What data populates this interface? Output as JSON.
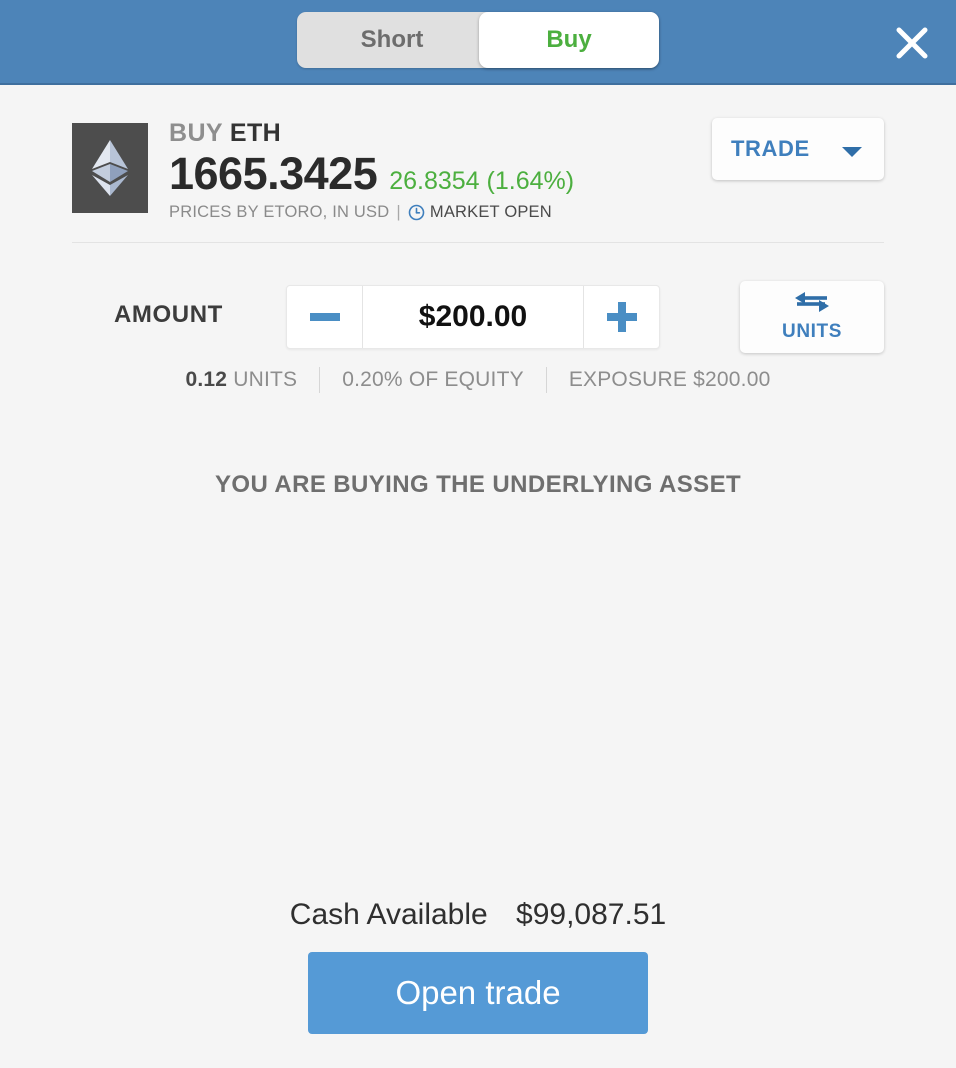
{
  "header": {
    "tabs": [
      {
        "label": "Short",
        "active": false
      },
      {
        "label": "Buy",
        "active": true
      }
    ],
    "close_icon": "close-icon",
    "bar_color": "#4d84b8"
  },
  "asset": {
    "logo_icon": "ethereum-logo-icon",
    "direction": "BUY",
    "symbol": "ETH",
    "price": "1665.3425",
    "change": "26.8354 (1.64%)",
    "change_color": "#4caf3f",
    "prices_by": "PRICES BY ETORO, IN USD",
    "separator": "|",
    "clock_icon": "clock-icon",
    "market_status": "MARKET OPEN",
    "order_type": "TRADE",
    "caret_icon": "chevron-down-icon"
  },
  "amount": {
    "label": "AMOUNT",
    "minus_icon": "minus-icon",
    "plus_icon": "plus-icon",
    "value": "$200.00",
    "units_toggle": {
      "icon": "swap-arrows-icon",
      "label": "UNITS"
    }
  },
  "stats": [
    {
      "value": "0.12",
      "label": "UNITS"
    },
    {
      "value": "",
      "label": "0.20% OF EQUITY"
    },
    {
      "value": "",
      "label": "EXPOSURE $200.00"
    }
  ],
  "notice": "YOU ARE BUYING THE UNDERLYING ASSET",
  "footer": {
    "cash_label": "Cash Available",
    "cash_value": "$99,087.51",
    "submit_label": "Open trade",
    "submit_color": "#559ad6"
  }
}
